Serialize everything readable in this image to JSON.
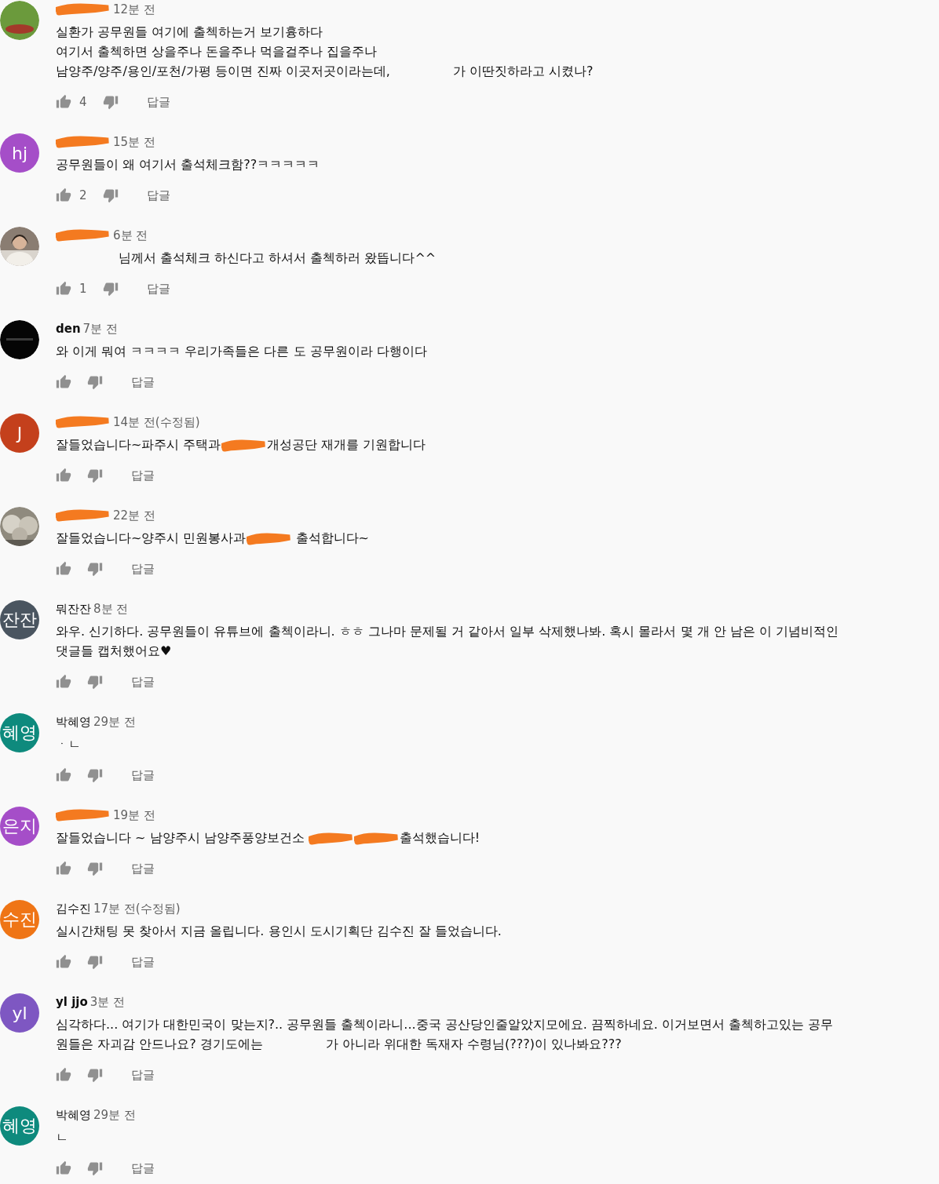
{
  "comments": [
    {
      "avatar": {
        "kind": "frog"
      },
      "author": {
        "kind": "redaction"
      },
      "time": "12분 전",
      "lines": [
        [
          {
            "kind": "text",
            "text": "실환가 공무원들 여기에 출첵하는거 보기흉하다"
          }
        ],
        [
          {
            "kind": "text",
            "text": "여기서 출첵하면 상을주나 돈을주나 먹을걸주나 집을주나"
          }
        ],
        [
          {
            "kind": "text",
            "text": "남양주/양주/용인/포천/가평 등이면 진짜 이곳저곳이라는데,"
          },
          {
            "kind": "gap"
          },
          {
            "kind": "text",
            "text": "가 이딴짓하라고 시켰나?"
          }
        ]
      ],
      "likes": "4",
      "reply": "답글"
    },
    {
      "avatar": {
        "kind": "letters",
        "text": "hj",
        "color": "#a54ec8"
      },
      "author": {
        "kind": "redaction"
      },
      "time": "15분 전",
      "lines": [
        [
          {
            "kind": "text",
            "text": "공무원들이 왜 여기서 출석체크함??ㅋㅋㅋㅋㅋ"
          }
        ]
      ],
      "likes": "2",
      "reply": "답글"
    },
    {
      "avatar": {
        "kind": "person"
      },
      "author": {
        "kind": "redaction"
      },
      "time": "6분 전",
      "lines": [
        [
          {
            "kind": "gap"
          },
          {
            "kind": "text",
            "text": "님께서 출석체크 하신다고 하셔서 출첵하러 왔뜹니다^^"
          }
        ]
      ],
      "likes": "1",
      "reply": "답글"
    },
    {
      "avatar": {
        "kind": "dark"
      },
      "author": {
        "kind": "text",
        "text": "den",
        "bold": true
      },
      "time": "7분 전",
      "lines": [
        [
          {
            "kind": "text",
            "text": "와 이게 뭐여 ㅋㅋㅋㅋ 우리가족들은 다른 도 공무원이라 다행이다"
          }
        ]
      ],
      "reply": "답글"
    },
    {
      "avatar": {
        "kind": "letters",
        "text": "J",
        "color": "#c4401c"
      },
      "author": {
        "kind": "redaction"
      },
      "time": "14분 전(수정됨)",
      "lines": [
        [
          {
            "kind": "text",
            "text": "잘들었습니다~파주시 주택과"
          },
          {
            "kind": "redaction"
          },
          {
            "kind": "text",
            "text": "개성공단 재개를 기원합니다"
          }
        ]
      ],
      "reply": "답글"
    },
    {
      "avatar": {
        "kind": "plant"
      },
      "author": {
        "kind": "redaction"
      },
      "time": "22분 전",
      "lines": [
        [
          {
            "kind": "text",
            "text": "잘들었습니다~양주시 민원봉사과"
          },
          {
            "kind": "redaction"
          },
          {
            "kind": "text",
            "text": " 출석합니다~"
          }
        ]
      ],
      "reply": "답글"
    },
    {
      "avatar": {
        "kind": "letters",
        "text": "잔잔",
        "color": "#4a5560"
      },
      "author": {
        "kind": "text",
        "text": "뭐잔잔",
        "bold": false
      },
      "time": "8분 전",
      "lines": [
        [
          {
            "kind": "text",
            "text": "와우. 신기하다. 공무원들이 유튜브에 출첵이라니. ㅎㅎ 그나마 문제될 거 같아서 일부 삭제했나봐. 혹시 몰라서 몇 개 안 남은 이 기념비적인"
          }
        ],
        [
          {
            "kind": "text",
            "text": "댓글들 캡처했어요♥"
          }
        ]
      ],
      "reply": "답글"
    },
    {
      "avatar": {
        "kind": "letters",
        "text": "혜영",
        "color": "#0e8a7d"
      },
      "author": {
        "kind": "text",
        "text": "박혜영",
        "bold": false
      },
      "time": "29분 전",
      "lines": [
        [
          {
            "kind": "text",
            "text": "ㆍㄴ"
          }
        ]
      ],
      "reply": "답글"
    },
    {
      "avatar": {
        "kind": "letters",
        "text": "은지",
        "color": "#a54ec8"
      },
      "author": {
        "kind": "redaction"
      },
      "time": "19분 전",
      "lines": [
        [
          {
            "kind": "text",
            "text": "잘들었습니다 ~ 남양주시 남양주풍양보건소 "
          },
          {
            "kind": "redaction"
          },
          {
            "kind": "redaction"
          },
          {
            "kind": "text",
            "text": "출석했습니다!"
          }
        ]
      ],
      "reply": "답글"
    },
    {
      "avatar": {
        "kind": "letters",
        "text": "수진",
        "color": "#ef7516"
      },
      "author": {
        "kind": "text",
        "text": "김수진",
        "bold": false
      },
      "time": "17분 전(수정됨)",
      "lines": [
        [
          {
            "kind": "text",
            "text": "실시간채팅 못 찾아서 지금 올립니다. 용인시 도시기획단 김수진 잘 들었습니다."
          }
        ]
      ],
      "reply": "답글"
    },
    {
      "avatar": {
        "kind": "letters",
        "text": "yl",
        "color": "#7e57c2"
      },
      "author": {
        "kind": "text",
        "text": "yl jjo",
        "bold": true
      },
      "time": "3분 전",
      "lines": [
        [
          {
            "kind": "text",
            "text": "심각하다... 여기가 대한민국이 맞는지?.. 공무원들 출첵이라니...중국 공산당인줄알았지모에요. 끔찍하네요. 이거보면서 출첵하고있는 공무"
          }
        ],
        [
          {
            "kind": "text",
            "text": "원들은 자괴감 안드나요? 경기도에는"
          },
          {
            "kind": "gap"
          },
          {
            "kind": "text",
            "text": "가 아니라 위대한 독재자 수령님(???)이 있나봐요???"
          }
        ]
      ],
      "reply": "답글"
    },
    {
      "avatar": {
        "kind": "letters",
        "text": "혜영",
        "color": "#0e8a7d"
      },
      "author": {
        "kind": "text",
        "text": "박혜영",
        "bold": false
      },
      "time": "29분 전",
      "lines": [
        [
          {
            "kind": "text",
            "text": "ㄴ"
          }
        ]
      ],
      "reply": "답글"
    }
  ]
}
